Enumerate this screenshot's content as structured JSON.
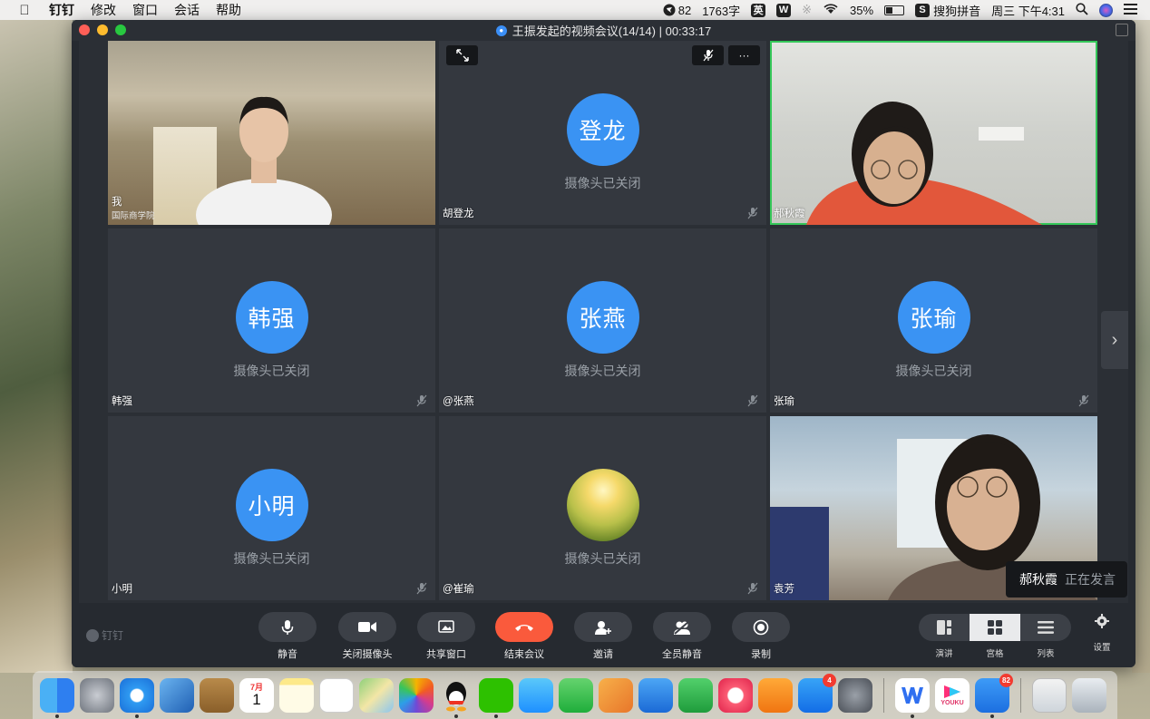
{
  "menubar": {
    "app": "钉钉",
    "items": [
      "修改",
      "窗口",
      "会话",
      "帮助"
    ],
    "status": {
      "dingtalk_count": "82",
      "word_count": "1763字",
      "ime_mode": "英",
      "battery": "35%",
      "input_method": "搜狗拼音",
      "clock": "周三 下午4:31"
    }
  },
  "window": {
    "title": "王振发起的视频会议(14/14) | 00:33:17"
  },
  "participants": [
    {
      "name": "我",
      "subtitle": "国际商学院",
      "video": true
    },
    {
      "name": "胡登龙",
      "avatar_text": "登龙",
      "camera_status": "摄像头已关闭",
      "video": false
    },
    {
      "name": "郝秋霞",
      "video": true,
      "speaking": true
    },
    {
      "name": "韩强",
      "avatar_text": "韩强",
      "camera_status": "摄像头已关闭",
      "video": false
    },
    {
      "name": "@张燕",
      "avatar_text": "张燕",
      "camera_status": "摄像头已关闭",
      "video": false
    },
    {
      "name": "张瑜",
      "avatar_text": "张瑜",
      "camera_status": "摄像头已关闭",
      "video": false
    },
    {
      "name": "小明",
      "avatar_text": "小明",
      "camera_status": "摄像头已关闭",
      "video": false
    },
    {
      "name": "@崔瑜",
      "avatar_text": "",
      "camera_status": "摄像头已关闭",
      "video": false
    },
    {
      "name": "袁芳",
      "video": true
    }
  ],
  "tile_controls": {
    "expand": "expand-icon",
    "more": "···"
  },
  "speaking_toast": {
    "name": "郝秋霞",
    "status": "正在发言"
  },
  "toolbar": {
    "brand": "钉钉",
    "buttons": [
      {
        "label": "静音",
        "icon": "microphone-icon"
      },
      {
        "label": "关闭摄像头",
        "icon": "camera-icon"
      },
      {
        "label": "共享窗口",
        "icon": "share-screen-icon"
      },
      {
        "label": "结束会议",
        "icon": "hang-up-icon",
        "color": "#fa5a3c"
      },
      {
        "label": "邀请",
        "icon": "invite-icon"
      },
      {
        "label": "全员静音",
        "icon": "mute-all-icon"
      },
      {
        "label": "录制",
        "icon": "record-icon"
      }
    ],
    "layouts": [
      "演讲",
      "宫格",
      "列表"
    ],
    "active_layout": "宫格",
    "settings": "设置"
  },
  "dock": {
    "apps": [
      "finder",
      "launchpad",
      "safari",
      "mail",
      "contacts",
      "calendar",
      "notes",
      "reminders",
      "maps",
      "photos",
      "qq",
      "wechat",
      "messages",
      "facetime",
      "pages",
      "keynote",
      "numbers",
      "music",
      "books",
      "app-store",
      "system-preferences",
      "wps",
      "youku",
      "dingtalk",
      "preview",
      "trash"
    ],
    "calendar_month": "7月",
    "calendar_day": "1",
    "appstore_badge": "4",
    "dingtalk_badge": "82",
    "youku_label": "YOUKU"
  },
  "colors": {
    "accent": "#3a93f3",
    "end_call": "#fa5a3c",
    "speaking_border": "#35c759",
    "window_bg": "#262a30",
    "tile_bg": "#34383f"
  }
}
